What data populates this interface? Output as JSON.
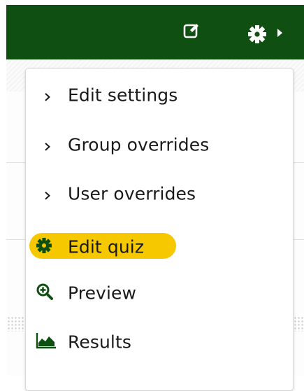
{
  "topbar": {
    "edit_icon": "edit-icon",
    "settings_icon": "gear-icon",
    "caret_icon": "caret-right-icon",
    "background_color": "#0f5012"
  },
  "menu": {
    "items": [
      {
        "label": "Edit settings",
        "icon": "chevron-right-icon"
      },
      {
        "label": "Group overrides",
        "icon": "chevron-right-icon"
      },
      {
        "label": "User overrides",
        "icon": "chevron-right-icon"
      },
      {
        "label": "Edit quiz",
        "icon": "gear-icon",
        "highlighted": true,
        "highlight_color": "#f6c800"
      },
      {
        "label": "Preview",
        "icon": "magnify-plus-icon"
      },
      {
        "label": "Results",
        "icon": "area-chart-icon"
      }
    ]
  },
  "colors": {
    "icon_green": "#0f5012",
    "text": "#1a1a1a"
  }
}
